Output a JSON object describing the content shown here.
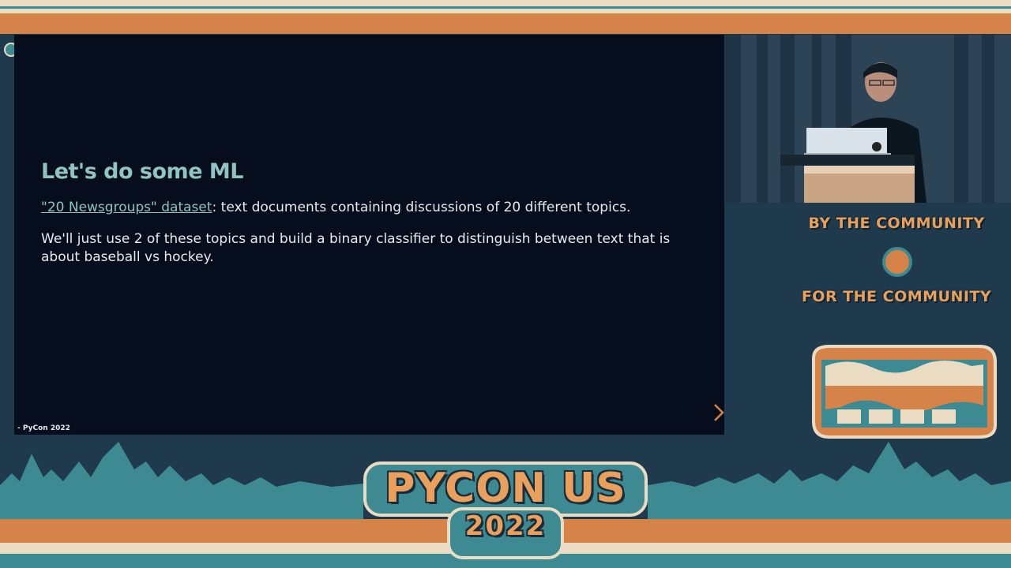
{
  "slide": {
    "title": "Let's do some ML",
    "link_text": "\"20 Newsgroups\" dataset",
    "line1_rest": ": text documents containing discussions of 20 different topics.",
    "line2": "We'll just use 2 of these topics and build a binary classifier to distinguish between text that is about baseball vs hockey.",
    "footer": "- PyCon 2022"
  },
  "sidebar": {
    "tagline_top": "BY THE COMMUNITY",
    "tagline_bottom": "FOR THE COMMUNITY",
    "badge_icon": "snake-wave-badge-icon"
  },
  "logo": {
    "name": "PYCON US",
    "year": "2022"
  },
  "colors": {
    "orange": "#d6834a",
    "teal": "#3d8a92",
    "cream": "#e9dcc2",
    "navy": "#1e3a4c",
    "slide_bg": "#060e1d",
    "accent_text": "#8fc4c2"
  },
  "icons": {
    "next": "chevron-right-icon"
  }
}
